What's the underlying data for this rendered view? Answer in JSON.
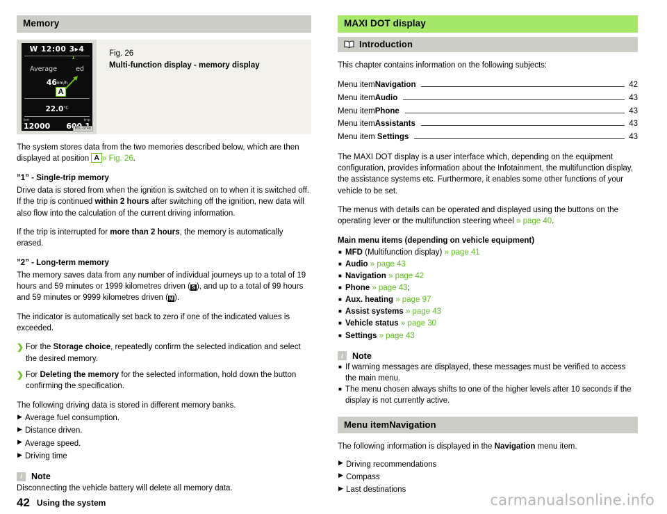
{
  "left": {
    "heading": "Memory",
    "figure": {
      "number": "Fig. 26",
      "title": "Multi-function display - memory display",
      "image_code": "B5L-0748",
      "display": {
        "top_line": "W  12:00 3▸4",
        "label_average": "Average",
        "label_average_tail": "ed",
        "callout": "A",
        "callout_number": "1",
        "speed": "46",
        "speed_unit": "km/h",
        "temperature": "22.0",
        "temperature_unit": "°C",
        "odo_label": "km",
        "odo_value": "12000",
        "trip_label": "trip",
        "trip_value": "600.1"
      }
    },
    "intro_p1_a": "The system stores data from the two memories described below, which are then displayed at position ",
    "intro_p1_marker": "A",
    "intro_p1_xref": "» Fig. 26",
    "intro_p1_end": ".",
    "h_single": "”1” - Single-trip memory",
    "single_p1_a": "Drive data is stored from when the ignition is switched on to when it is switched off. If the trip is continued ",
    "single_p1_b": "within 2 hours",
    "single_p1_c": " after switching off the ignition, new data will also flow into the calculation of the current driving information.",
    "single_p2_a": "If the trip is interrupted for ",
    "single_p2_b": "more than 2 hours",
    "single_p2_c": ", the memory is automatically erased.",
    "h_long": "”2” - Long-term memory",
    "long_p1_a": "The memory saves data from any number of individual journeys up to a total of 19 hours and 59 minutes or 1999 kilometres driven (",
    "long_p1_sym1": "S",
    "long_p1_b": "), and up to a total of 99 hours and 59 minutes or 9999 kilometres driven (",
    "long_p1_sym2": "M",
    "long_p1_c": ").",
    "indicator_p": "The indicator is automatically set back to zero if one of the indicated values is exceeded.",
    "chevron_items": [
      {
        "pre": "For the ",
        "bold": "Storage choice",
        "post": ", repeatedly confirm the selected indication and select the desired memory."
      },
      {
        "pre": "For ",
        "bold": "Deleting the memory",
        "post": " for the selected information, hold down the button confirming the specification."
      }
    ],
    "stored_head": "The following driving data is stored in different memory banks.",
    "stored_items": [
      "Average fuel consumption.",
      "Distance driven.",
      "Average speed.",
      "Driving time"
    ],
    "note_title": "Note",
    "note_text": "Disconnecting the vehicle battery will delete all memory data."
  },
  "right": {
    "heading": "MAXI DOT display",
    "intro_heading": "Introduction",
    "intro_lead": "This chapter contains information on the following subjects:",
    "toc": [
      {
        "prefix": "Menu item",
        "name": "Navigation",
        "page": "42"
      },
      {
        "prefix": "Menu item",
        "name": "Audio",
        "page": "43"
      },
      {
        "prefix": "Menu item",
        "name": "Phone",
        "page": "43"
      },
      {
        "prefix": "Menu item",
        "name": "Assistants",
        "page": "43"
      },
      {
        "prefix": "Menu item ",
        "name": "Settings",
        "page": "43"
      }
    ],
    "p1": "The MAXI DOT display is a user interface which, depending on the equipment configuration, provides information about the Infotainment, the multifunction display, the assistance systems etc. Furthermore, it enables some other functions of your vehicle to be set.",
    "p2_a": "The menus with details can be operated and displayed using the buttons on the operating lever or the multifunction steering wheel ",
    "p2_xref": "» page 40",
    "p2_end": ".",
    "main_menu_head": "Main menu items (depending on vehicle equipment)",
    "main_menu_items": [
      {
        "label": "MFD",
        "extra": " (Multifunction display)",
        "xref": "» page 41",
        "tail": ""
      },
      {
        "label": "Audio",
        "extra": "",
        "xref": "» page 43",
        "tail": ""
      },
      {
        "label": "Navigation",
        "extra": "",
        "xref": "» page 42",
        "tail": ""
      },
      {
        "label": "Phone",
        "extra": "",
        "xref": "» page 43",
        "tail": ";"
      },
      {
        "label": "Aux. heating",
        "extra": "",
        "xref": "» page 97",
        "tail": ""
      },
      {
        "label": "Assist systems",
        "extra": "",
        "xref": "» page 43",
        "tail": ""
      },
      {
        "label": "Vehicle status",
        "extra": "",
        "xref": "» page 30",
        "tail": ""
      },
      {
        "label": "Settings",
        "extra": "",
        "xref": "» page 43",
        "tail": ""
      }
    ],
    "note_title": "Note",
    "note_items": [
      "If warning messages are displayed, these messages must be verified to access the main menu.",
      "The menu chosen always shifts to one of the higher levels after 10 seconds if the display is not currently active."
    ],
    "menu_nav_heading_prefix": "Menu item",
    "menu_nav_heading_name": "Navigation",
    "menu_nav_lead_a": "The following information is displayed in the ",
    "menu_nav_lead_b": "Navigation",
    "menu_nav_lead_c": " menu item.",
    "menu_nav_items": [
      "Driving recommendations",
      "Compass",
      "Last destinations"
    ]
  },
  "footer": {
    "page_number": "42",
    "section": "Using the system",
    "watermark": "carmanualsonline.info"
  },
  "colors": {
    "heading_bar": "#cdcdc8",
    "chapter_bar": "#a5e86a",
    "xref_green": "#5dbb1e",
    "figure_bg": "#f2f1ec"
  }
}
